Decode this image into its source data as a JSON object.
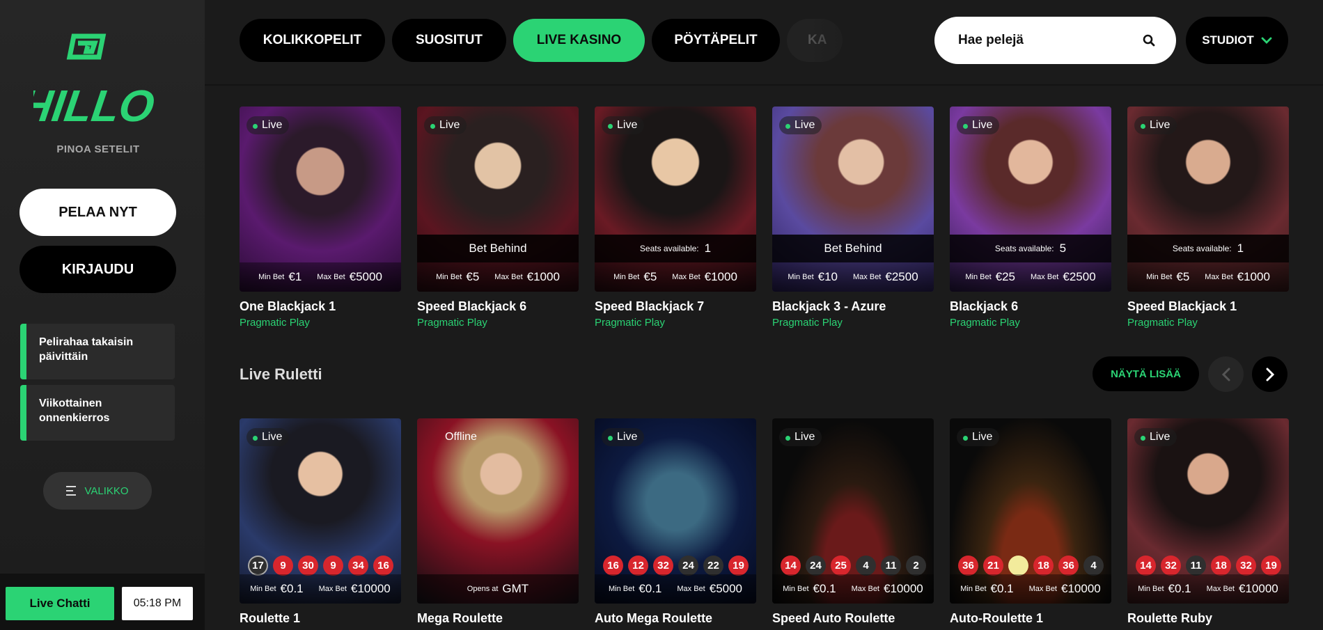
{
  "sidebar": {
    "logo_text": "HILLO",
    "tagline": "PINOA SETELIT",
    "play_label": "PELAA NYT",
    "login_label": "KIRJAUDU",
    "promos": [
      {
        "label": "Pelirahaa takaisin päivittäin"
      },
      {
        "label": "Viikottainen onnenkierros"
      }
    ],
    "menu_label": "VALIKKO",
    "chat_label": "Live Chatti",
    "clock": "05:18 PM"
  },
  "nav": {
    "tabs": [
      {
        "label": "KOLIKKOPELIT",
        "active": false
      },
      {
        "label": "SUOSITUT",
        "active": false
      },
      {
        "label": "LIVE KASINO",
        "active": true
      },
      {
        "label": "PÖYTÄPELIT",
        "active": false
      },
      {
        "label": "KA",
        "active": false
      }
    ],
    "search_placeholder": "Hae pelejä",
    "studios_label": "STUDIOT"
  },
  "blackjack": [
    {
      "title": "One Blackjack 1",
      "provider": "Pragmatic Play",
      "status": "Live",
      "strip": "",
      "seats": "",
      "min_bet": "€1",
      "max_bet": "€5000"
    },
    {
      "title": "Speed Blackjack 6",
      "provider": "Pragmatic Play",
      "status": "Live",
      "strip": "Bet Behind",
      "seats": "",
      "min_bet": "€5",
      "max_bet": "€1000"
    },
    {
      "title": "Speed Blackjack 7",
      "provider": "Pragmatic Play",
      "status": "Live",
      "strip": "",
      "seats": "1",
      "min_bet": "€5",
      "max_bet": "€1000"
    },
    {
      "title": "Blackjack 3 - Azure",
      "provider": "Pragmatic Play",
      "status": "Live",
      "strip": "Bet Behind",
      "seats": "",
      "min_bet": "€10",
      "max_bet": "€2500"
    },
    {
      "title": "Blackjack 6",
      "provider": "Pragmatic Play",
      "status": "Live",
      "strip": "",
      "seats": "5",
      "min_bet": "€25",
      "max_bet": "€2500"
    },
    {
      "title": "Speed Blackjack 1",
      "provider": "Pragmatic Play",
      "status": "Live",
      "strip": "",
      "seats": "1",
      "min_bet": "€5",
      "max_bet": "€1000"
    }
  ],
  "labels": {
    "min_bet": "Min Bet",
    "max_bet": "Max Bet",
    "seats_available": "Seats available:",
    "opens_at": "Opens at",
    "tz": "GMT"
  },
  "roulette_section": {
    "title": "Live Ruletti",
    "more_label": "NÄYTÄ LISÄÄ"
  },
  "roulette": [
    {
      "title": "Roulette 1",
      "status": "Live",
      "balls": [
        "17",
        "9",
        "30",
        "9",
        "34",
        "16"
      ],
      "colors": [
        "black",
        "red",
        "red",
        "red",
        "red",
        "red"
      ],
      "min_bet": "€0.1",
      "max_bet": "€10000"
    },
    {
      "title": "Mega Roulette",
      "status": "Offline",
      "balls": [],
      "colors": [],
      "min_bet": "",
      "max_bet": ""
    },
    {
      "title": "Auto Mega Roulette",
      "status": "Live",
      "balls": [
        "16",
        "12",
        "32",
        "24",
        "22",
        "19"
      ],
      "colors": [
        "red",
        "red",
        "red",
        "black",
        "black",
        "red"
      ],
      "min_bet": "€0.1",
      "max_bet": "€5000"
    },
    {
      "title": "Speed Auto Roulette",
      "status": "Live",
      "balls": [
        "14",
        "24",
        "25",
        "4",
        "11",
        "2"
      ],
      "colors": [
        "red",
        "black",
        "red",
        "black",
        "black",
        "black"
      ],
      "min_bet": "€0.1",
      "max_bet": "€10000"
    },
    {
      "title": "Auto-Roulette 1",
      "status": "Live",
      "balls": [
        "36",
        "21",
        "",
        "18",
        "36",
        "4"
      ],
      "colors": [
        "red",
        "red",
        "yellow",
        "red",
        "red",
        "black"
      ],
      "min_bet": "€0.1",
      "max_bet": "€10000"
    },
    {
      "title": "Roulette Ruby",
      "status": "Live",
      "balls": [
        "14",
        "32",
        "11",
        "18",
        "32",
        "19"
      ],
      "colors": [
        "red",
        "red",
        "black",
        "red",
        "red",
        "red"
      ],
      "min_bet": "€0.1",
      "max_bet": "€10000"
    }
  ],
  "colors": {
    "accent": "#2bd374",
    "red": "#d8262d"
  }
}
